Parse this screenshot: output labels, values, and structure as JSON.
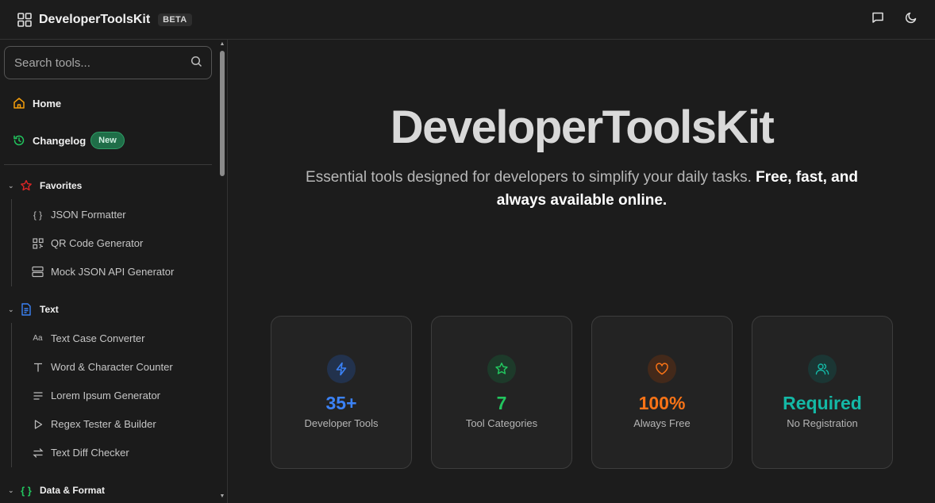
{
  "header": {
    "brand": "DeveloperToolsKit",
    "badge": "BETA"
  },
  "sidebar": {
    "search_placeholder": "Search tools...",
    "home_label": "Home",
    "changelog_label": "Changelog",
    "changelog_badge": "New",
    "sections": [
      {
        "title": "Favorites",
        "items": [
          "JSON Formatter",
          "QR Code Generator",
          "Mock JSON API Generator"
        ]
      },
      {
        "title": "Text",
        "items": [
          "Text Case Converter",
          "Word & Character Counter",
          "Lorem Ipsum Generator",
          "Regex Tester & Builder",
          "Text Diff Checker"
        ]
      },
      {
        "title": "Data & Format",
        "items": []
      }
    ],
    "text_item_icon_glyph": "Aa"
  },
  "hero": {
    "title": "DeveloperToolsKit",
    "subtitle_plain": "Essential tools designed for developers to simplify your daily tasks. ",
    "subtitle_bold": "Free, fast, and always available online."
  },
  "stats": [
    {
      "value": "35+",
      "label": "Developer Tools",
      "color": "#3b82f6",
      "icon": "bolt-icon"
    },
    {
      "value": "7",
      "label": "Tool Categories",
      "color": "#22c55e",
      "icon": "star-icon"
    },
    {
      "value": "100%",
      "label": "Always Free",
      "color": "#f97316",
      "icon": "heart-icon"
    },
    {
      "value": "Required",
      "label": "No Registration",
      "color": "#14b8a6",
      "icon": "users-icon"
    }
  ],
  "colors": {
    "home_icon": "#f59e0b",
    "changelog_icon": "#22c55e",
    "favorites_icon": "#dc2626",
    "text_icon": "#3b82f6",
    "data_icon": "#22c55e"
  }
}
